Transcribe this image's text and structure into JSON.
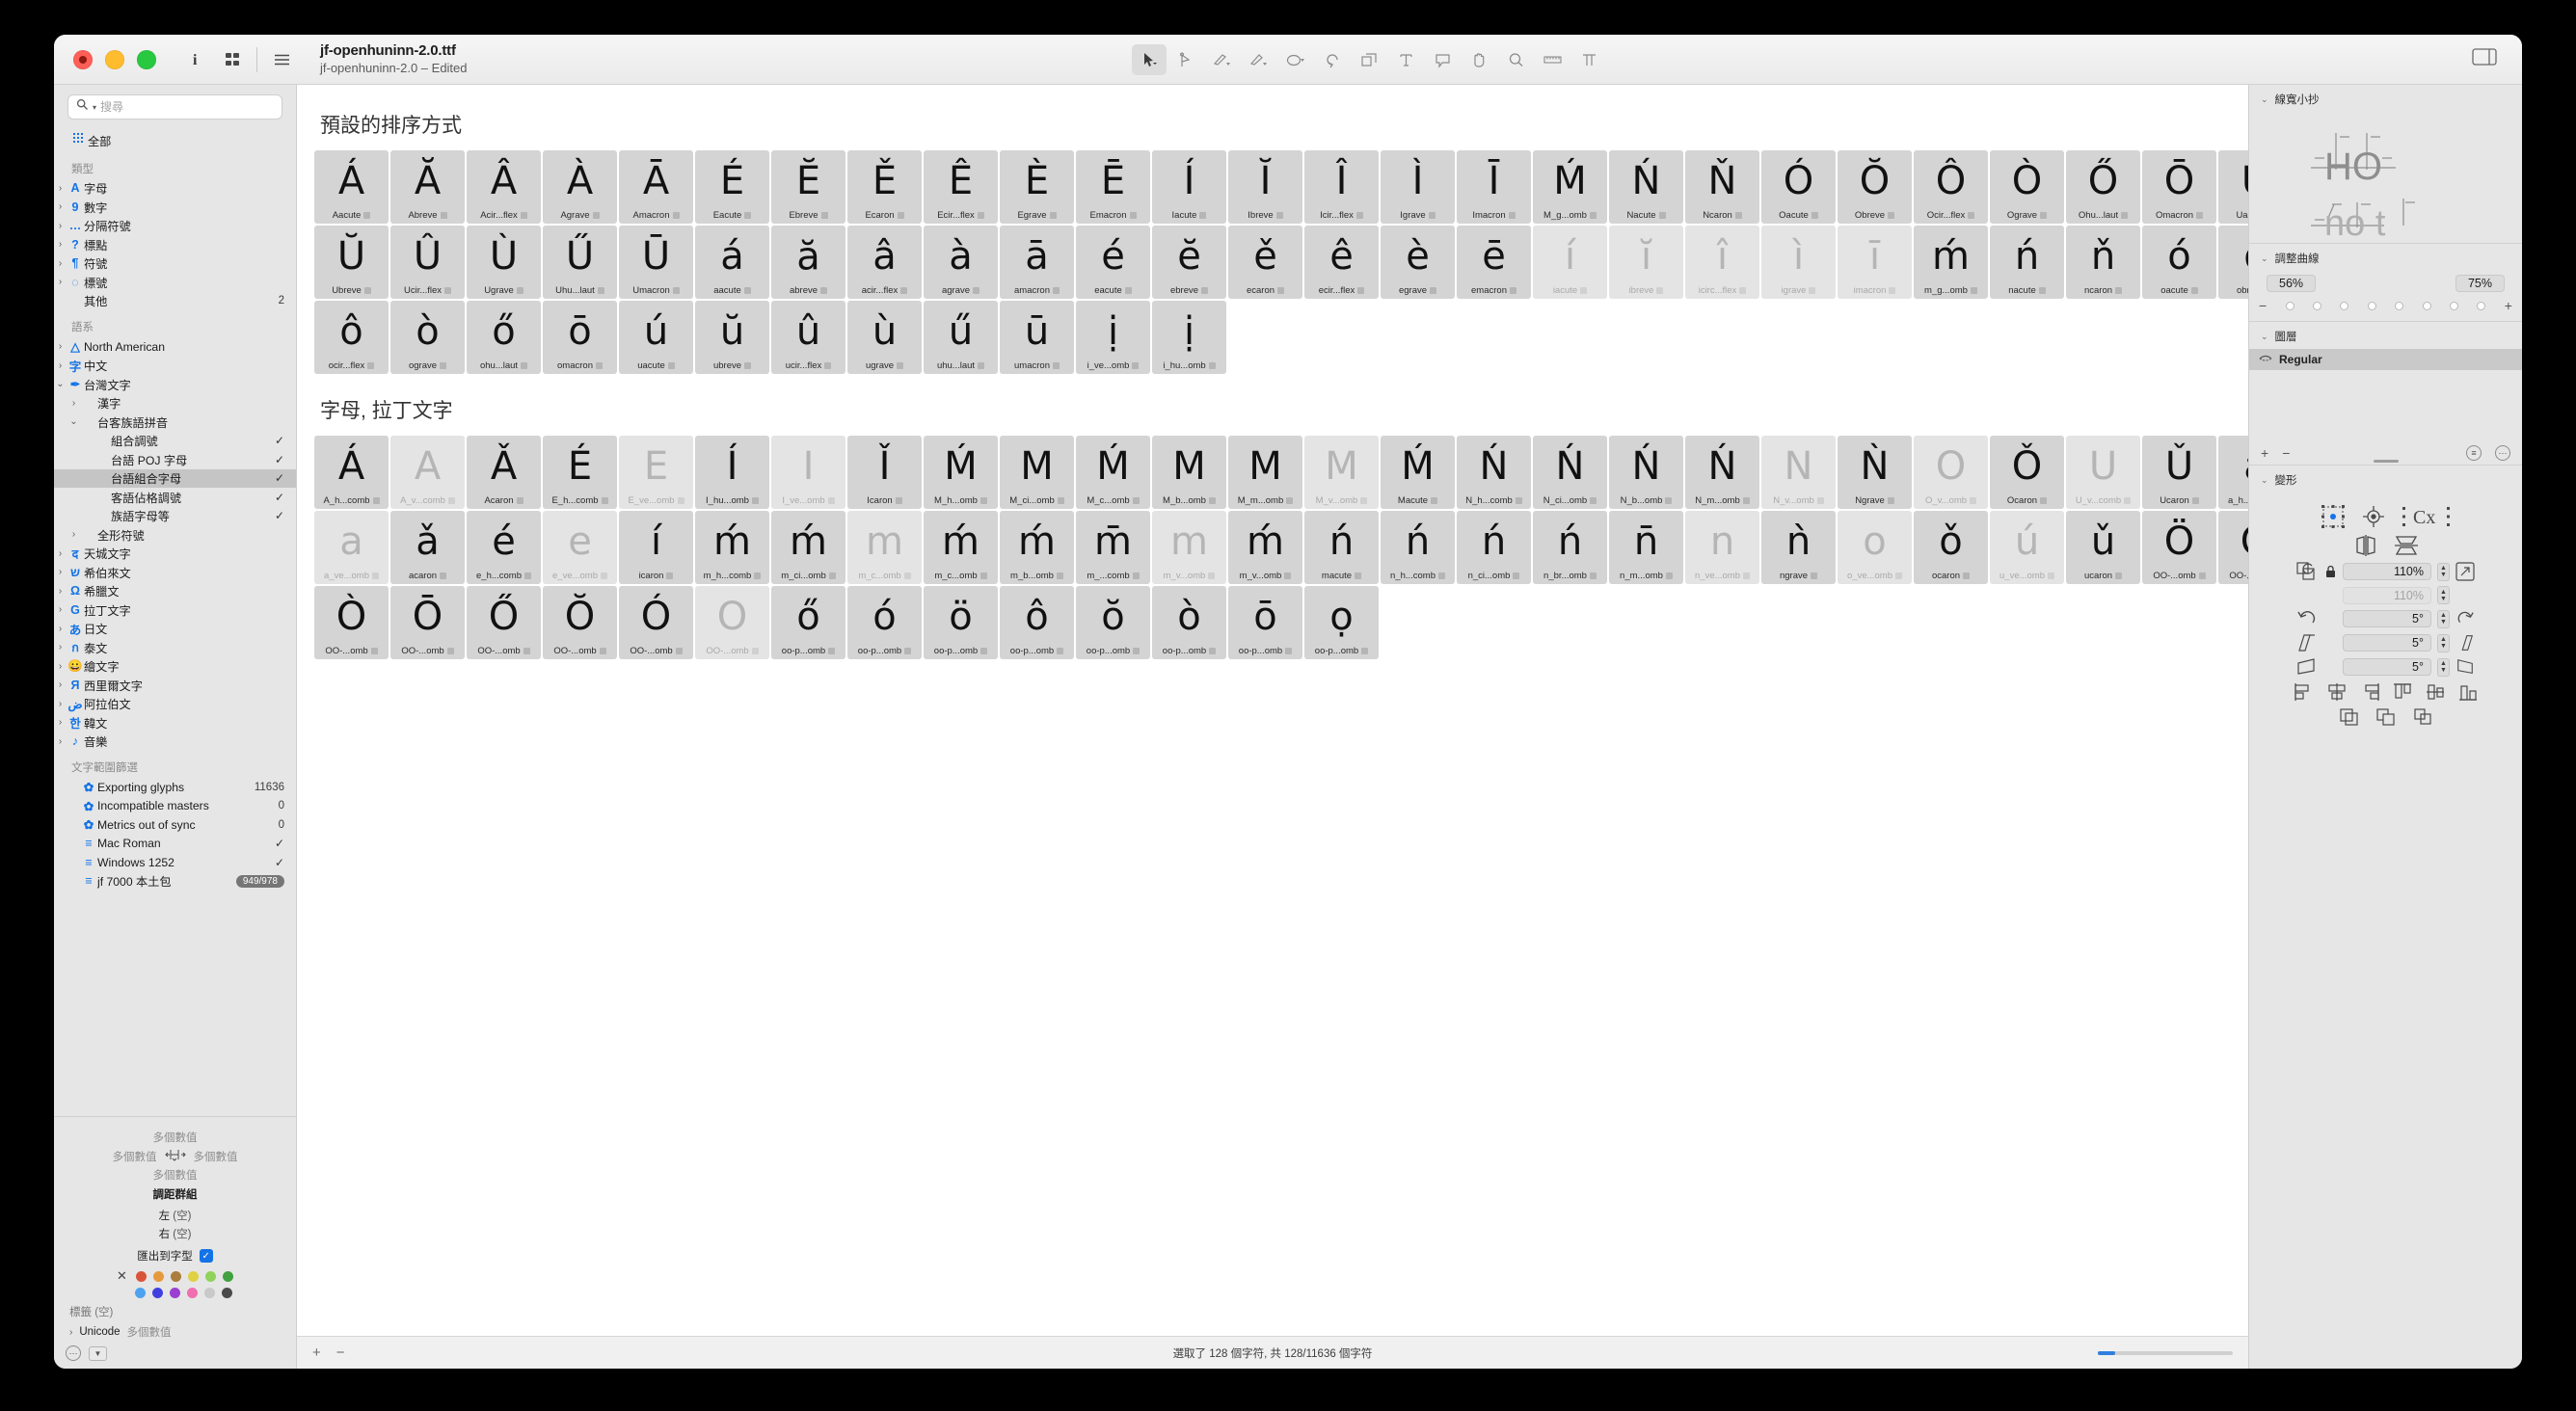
{
  "window": {
    "title": "jf-openhuninn-2.0.ttf",
    "subtitle": "jf-openhuninn-2.0 – Edited"
  },
  "titlebar": {
    "info_icon": "info-icon",
    "grid_icon": "grid-view-icon",
    "list_icon": "list-view-icon",
    "panel_toggle_icon": "right-panel-toggle-icon",
    "tools": [
      {
        "name": "select-tool",
        "glyph": "arrow",
        "active": true
      },
      {
        "name": "draw-tool",
        "glyph": "pen",
        "active": false
      },
      {
        "name": "pencil-tool",
        "glyph": "pencil",
        "active": false
      },
      {
        "name": "primitives-tool",
        "glyph": "knife",
        "active": false
      },
      {
        "name": "shape-tool",
        "glyph": "circle",
        "active": false
      },
      {
        "name": "rotate-tool",
        "glyph": "rotate",
        "active": false
      },
      {
        "name": "scale-tool",
        "glyph": "scale",
        "active": false
      },
      {
        "name": "text-tool",
        "glyph": "T",
        "active": false
      },
      {
        "name": "annotation-tool",
        "glyph": "speech",
        "active": false
      },
      {
        "name": "hand-tool",
        "glyph": "hand",
        "active": false
      },
      {
        "name": "zoom-tool",
        "glyph": "magnifier",
        "active": false
      },
      {
        "name": "measure-tool",
        "glyph": "ruler",
        "active": false
      },
      {
        "name": "text-preview-tool",
        "glyph": "TT",
        "active": false
      }
    ]
  },
  "sidebar": {
    "search": {
      "placeholder": "搜尋"
    },
    "all": {
      "label": "全部",
      "icon": "all-glyphs-icon"
    },
    "groups": [
      {
        "header": "類型",
        "items": [
          {
            "label": "字母",
            "icon": "A",
            "twisty": ">",
            "indent": 0
          },
          {
            "label": "數字",
            "icon": "9",
            "twisty": ">",
            "indent": 0
          },
          {
            "label": "分隔符號",
            "icon": "…",
            "twisty": ">",
            "indent": 0
          },
          {
            "label": "標點",
            "icon": "?",
            "twisty": ">",
            "indent": 0
          },
          {
            "label": "符號",
            "icon": "¶",
            "twisty": ">",
            "indent": 0
          },
          {
            "label": "標號",
            "icon": "◌",
            "twisty": ">",
            "indent": 0
          },
          {
            "label": "其他",
            "icon": "",
            "twisty": "",
            "indent": 0,
            "value": "2"
          }
        ]
      },
      {
        "header": "語系",
        "items": [
          {
            "label": "North American",
            "icon": "△",
            "twisty": ">",
            "indent": 0
          },
          {
            "label": "中文",
            "icon": "字",
            "twisty": ">",
            "indent": 0
          },
          {
            "label": "台灣文字",
            "icon": "✒",
            "twisty": "v",
            "indent": 0
          },
          {
            "label": "漢字",
            "icon": "",
            "twisty": ">",
            "indent": 1
          },
          {
            "label": "台客族語拼音",
            "icon": "",
            "twisty": "v",
            "indent": 1
          },
          {
            "label": "組合調號",
            "icon": "",
            "twisty": "",
            "indent": 2,
            "check": true
          },
          {
            "label": "台語 POJ 字母",
            "icon": "",
            "twisty": "",
            "indent": 2,
            "check": true
          },
          {
            "label": "台語組合字母",
            "icon": "",
            "twisty": "",
            "indent": 2,
            "check": true,
            "selected": true
          },
          {
            "label": "客語佔格調號",
            "icon": "",
            "twisty": "",
            "indent": 2,
            "check": true
          },
          {
            "label": "族語字母等",
            "icon": "",
            "twisty": "",
            "indent": 2,
            "check": true
          },
          {
            "label": "全形符號",
            "icon": "",
            "twisty": ">",
            "indent": 1
          },
          {
            "label": "天城文字",
            "icon": "द",
            "twisty": ">",
            "indent": 0
          },
          {
            "label": "希伯來文",
            "icon": "ש",
            "twisty": ">",
            "indent": 0
          },
          {
            "label": "希臘文",
            "icon": "Ω",
            "twisty": ">",
            "indent": 0
          },
          {
            "label": "拉丁文字",
            "icon": "G",
            "twisty": ">",
            "indent": 0
          },
          {
            "label": "日文",
            "icon": "あ",
            "twisty": ">",
            "indent": 0
          },
          {
            "label": "泰文",
            "icon": "ก",
            "twisty": ">",
            "indent": 0
          },
          {
            "label": "繪文字",
            "icon": "😀",
            "twisty": ">",
            "indent": 0
          },
          {
            "label": "西里爾文字",
            "icon": "Я",
            "twisty": ">",
            "indent": 0
          },
          {
            "label": "阿拉伯文",
            "icon": "ض",
            "twisty": ">",
            "indent": 0
          },
          {
            "label": "韓文",
            "icon": "한",
            "twisty": ">",
            "indent": 0
          },
          {
            "label": "音樂",
            "icon": "♪",
            "twisty": ">",
            "indent": 0
          }
        ]
      },
      {
        "header": "文字範圍篩選",
        "items": [
          {
            "label": "Exporting glyphs",
            "icon": "✿",
            "twisty": "",
            "indent": 1,
            "value": "11636"
          },
          {
            "label": "Incompatible masters",
            "icon": "✿",
            "twisty": "",
            "indent": 1,
            "value": "0"
          },
          {
            "label": "Metrics out of sync",
            "icon": "✿",
            "twisty": "",
            "indent": 1,
            "value": "0"
          },
          {
            "label": "Mac Roman",
            "icon": "≡",
            "twisty": "",
            "indent": 1,
            "check": true
          },
          {
            "label": "Windows 1252",
            "icon": "≡",
            "twisty": "",
            "indent": 1,
            "check": true
          },
          {
            "label": "jf 7000 本土包",
            "icon": "≡",
            "twisty": "",
            "indent": 1,
            "badge": "949/978"
          }
        ]
      }
    ]
  },
  "left_inspector": {
    "multi_top": "多個數值",
    "multi_left": "多個數值",
    "multi_right": "多個數值",
    "multi_bottom": "多個數值",
    "kerning_group_title": "調距群組",
    "left_label": "左",
    "left_value": "(空)",
    "right_label": "右",
    "right_value": "(空)",
    "export_label": "匯出到字型",
    "export_checked": true,
    "colors_row1": [
      "#d9533b",
      "#e79a3b",
      "#ab7c3b",
      "#e0d142",
      "#8fd35a",
      "#3fa13f"
    ],
    "colors_row2": [
      "#4ea3f0",
      "#4040e0",
      "#9a3fd0",
      "#ef6fb0",
      "#c9c9c9",
      "#4a4a4a"
    ],
    "tag_label": "標籤",
    "tag_value": "(空)",
    "unicode_label": "Unicode",
    "unicode_value": "多個數值"
  },
  "main": {
    "sections": [
      {
        "title": "預設的排序方式",
        "glyphs": [
          {
            "g": "Á",
            "n": "Aacute"
          },
          {
            "g": "Ă",
            "n": "Abreve"
          },
          {
            "g": "Â",
            "n": "Acir...flex"
          },
          {
            "g": "À",
            "n": "Agrave"
          },
          {
            "g": "Ā",
            "n": "Amacron"
          },
          {
            "g": "É",
            "n": "Eacute"
          },
          {
            "g": "Ĕ",
            "n": "Ebreve"
          },
          {
            "g": "Ě",
            "n": "Ecaron"
          },
          {
            "g": "Ê",
            "n": "Ecir...flex"
          },
          {
            "g": "È",
            "n": "Egrave"
          },
          {
            "g": "Ē",
            "n": "Emacron"
          },
          {
            "g": "Í",
            "n": "Iacute"
          },
          {
            "g": "Ĭ",
            "n": "Ibreve"
          },
          {
            "g": "Î",
            "n": "Icir...flex"
          },
          {
            "g": "Ì",
            "n": "Igrave"
          },
          {
            "g": "Ī",
            "n": "Imacron"
          },
          {
            "g": "Ḿ",
            "n": "M_g...omb"
          },
          {
            "g": "Ń",
            "n": "Nacute"
          },
          {
            "g": "Ň",
            "n": "Ncaron"
          },
          {
            "g": "Ó",
            "n": "Oacute"
          },
          {
            "g": "Ŏ",
            "n": "Obreve"
          },
          {
            "g": "Ô",
            "n": "Ocir...flex"
          },
          {
            "g": "Ò",
            "n": "Ograve"
          },
          {
            "g": "Ő",
            "n": "Ohu...laut"
          },
          {
            "g": "Ō",
            "n": "Omacron"
          },
          {
            "g": "Ú",
            "n": "Uacute"
          },
          {
            "g": "Ŭ",
            "n": "Ubreve"
          },
          {
            "g": "Û",
            "n": "Ucir...flex"
          },
          {
            "g": "Ù",
            "n": "Ugrave"
          },
          {
            "g": "Ű",
            "n": "Uhu...laut"
          },
          {
            "g": "Ū",
            "n": "Umacron"
          },
          {
            "g": "á",
            "n": "aacute"
          },
          {
            "g": "ă",
            "n": "abreve"
          },
          {
            "g": "â",
            "n": "acir...flex"
          },
          {
            "g": "à",
            "n": "agrave"
          },
          {
            "g": "ā",
            "n": "amacron"
          },
          {
            "g": "é",
            "n": "eacute"
          },
          {
            "g": "ĕ",
            "n": "ebreve"
          },
          {
            "g": "ě",
            "n": "ecaron"
          },
          {
            "g": "ê",
            "n": "ecir...flex"
          },
          {
            "g": "è",
            "n": "egrave"
          },
          {
            "g": "ē",
            "n": "emacron"
          },
          {
            "g": "í",
            "n": "iacute",
            "dim": true
          },
          {
            "g": "ĭ",
            "n": "ibreve",
            "dim": true
          },
          {
            "g": "î",
            "n": "icirc...flex",
            "dim": true
          },
          {
            "g": "ì",
            "n": "igrave",
            "dim": true
          },
          {
            "g": "ī",
            "n": "imacron",
            "dim": true
          },
          {
            "g": "ḿ",
            "n": "m_g...omb"
          },
          {
            "g": "ń",
            "n": "nacute"
          },
          {
            "g": "ň",
            "n": "ncaron"
          },
          {
            "g": "ó",
            "n": "oacute"
          },
          {
            "g": "ŏ",
            "n": "obreve"
          },
          {
            "g": "ô",
            "n": "ocir...flex"
          },
          {
            "g": "ò",
            "n": "ograve"
          },
          {
            "g": "ő",
            "n": "ohu...laut"
          },
          {
            "g": "ō",
            "n": "omacron"
          },
          {
            "g": "ú",
            "n": "uacute"
          },
          {
            "g": "ŭ",
            "n": "ubreve"
          },
          {
            "g": "û",
            "n": "ucir...flex"
          },
          {
            "g": "ù",
            "n": "ugrave"
          },
          {
            "g": "ű",
            "n": "uhu...laut"
          },
          {
            "g": "ū",
            "n": "umacron"
          },
          {
            "g": "ị",
            "n": "i_ve...omb"
          },
          {
            "g": "ị",
            "n": "i_hu...omb"
          }
        ]
      },
      {
        "title": "字母, 拉丁文字",
        "glyphs": [
          {
            "g": "Á",
            "n": "A_h...comb"
          },
          {
            "g": "A",
            "n": "A_v...comb",
            "dim": true
          },
          {
            "g": "Ǎ",
            "n": "Acaron"
          },
          {
            "g": "É",
            "n": "E_h...comb"
          },
          {
            "g": "E",
            "n": "E_ve...omb",
            "dim": true
          },
          {
            "g": "Í",
            "n": "I_hu...omb"
          },
          {
            "g": "I",
            "n": "I_ve...omb",
            "dim": true
          },
          {
            "g": "Ǐ",
            "n": "Icaron"
          },
          {
            "g": "Ḿ",
            "n": "M_h...omb"
          },
          {
            "g": "M",
            "n": "M_ci...omb"
          },
          {
            "g": "Ḿ",
            "n": "M_c...omb"
          },
          {
            "g": "M",
            "n": "M_b...omb"
          },
          {
            "g": "M",
            "n": "M_m...omb"
          },
          {
            "g": "M",
            "n": "M_v...omb",
            "dim": true
          },
          {
            "g": "Ḿ",
            "n": "Macute"
          },
          {
            "g": "Ń",
            "n": "N_h...comb"
          },
          {
            "g": "Ń",
            "n": "N_ci...omb"
          },
          {
            "g": "Ń",
            "n": "N_b...omb"
          },
          {
            "g": "Ń",
            "n": "N_m...omb"
          },
          {
            "g": "N",
            "n": "N_v...omb",
            "dim": true
          },
          {
            "g": "Ǹ",
            "n": "Ngrave"
          },
          {
            "g": "O",
            "n": "O_v...omb",
            "dim": true
          },
          {
            "g": "Ǒ",
            "n": "Ocaron"
          },
          {
            "g": "U",
            "n": "U_v...comb",
            "dim": true
          },
          {
            "g": "Ǔ",
            "n": "Ucaron"
          },
          {
            "g": "á",
            "n": "a_h...comb"
          },
          {
            "g": "a",
            "n": "a_ve...omb",
            "dim": true
          },
          {
            "g": "ǎ",
            "n": "acaron"
          },
          {
            "g": "é",
            "n": "e_h...comb"
          },
          {
            "g": "e",
            "n": "e_ve...omb",
            "dim": true
          },
          {
            "g": "í",
            "n": "icaron"
          },
          {
            "g": "ḿ",
            "n": "m_h...comb"
          },
          {
            "g": "ḿ",
            "n": "m_ci...omb"
          },
          {
            "g": "m",
            "n": "m_c...omb",
            "dim": true
          },
          {
            "g": "ḿ",
            "n": "m_c...omb"
          },
          {
            "g": "ḿ",
            "n": "m_b...omb"
          },
          {
            "g": "m̄",
            "n": "m_...comb"
          },
          {
            "g": "m",
            "n": "m_v...omb",
            "dim": true
          },
          {
            "g": "ḿ",
            "n": "m_v...omb"
          },
          {
            "g": "ń",
            "n": "macute"
          },
          {
            "g": "ń",
            "n": "n_h...comb"
          },
          {
            "g": "ń",
            "n": "n_ci...omb"
          },
          {
            "g": "ń",
            "n": "n_br...omb"
          },
          {
            "g": "n̄",
            "n": "n_m...omb"
          },
          {
            "g": "n",
            "n": "n_ve...omb",
            "dim": true
          },
          {
            "g": "ǹ",
            "n": "ngrave"
          },
          {
            "g": "o",
            "n": "o_ve...omb",
            "dim": true
          },
          {
            "g": "ǒ",
            "n": "ocaron"
          },
          {
            "g": "ú",
            "n": "u_ve...omb",
            "dim": true
          },
          {
            "g": "ǔ",
            "n": "ucaron"
          },
          {
            "g": "Ö",
            "n": "OO-...omb"
          },
          {
            "g": "Ô",
            "n": "OO-...omb"
          },
          {
            "g": "Ò",
            "n": "OO-...omb"
          },
          {
            "g": "Ō",
            "n": "OO-...omb"
          },
          {
            "g": "Ő",
            "n": "OO-...omb"
          },
          {
            "g": "Ŏ",
            "n": "OO-...omb"
          },
          {
            "g": "Ó",
            "n": "OO-...omb"
          },
          {
            "g": "O",
            "n": "OO-...omb",
            "dim": true
          },
          {
            "g": "ő",
            "n": "oo-p...omb"
          },
          {
            "g": "ó",
            "n": "oo-p...omb"
          },
          {
            "g": "ö",
            "n": "oo-p...omb"
          },
          {
            "g": "ô",
            "n": "oo-p...omb"
          },
          {
            "g": "ŏ",
            "n": "oo-p...omb"
          },
          {
            "g": "ò",
            "n": "oo-p...omb"
          },
          {
            "g": "ō",
            "n": "oo-p...omb"
          },
          {
            "g": "ọ",
            "n": "oo-p...omb"
          }
        ]
      }
    ]
  },
  "statusbar": {
    "plus": "+",
    "minus": "−",
    "status": "選取了 128 個字符, 共 128/11636 個字符"
  },
  "right_panel": {
    "width_cheatsheet": {
      "title": "線寬小抄",
      "row1": "HO",
      "row2": "no t"
    },
    "adjust_curve": {
      "title": "調整曲線",
      "left_pct": "56%",
      "right_pct": "75%",
      "minus": "−",
      "plus": "+",
      "dots": 8
    },
    "layers": {
      "title": "圖層",
      "items": [
        {
          "label": "Regular",
          "selected": true
        }
      ]
    },
    "transform": {
      "title": "變形",
      "scale_value": "110%",
      "scale_value_2": "110%",
      "rotate_value": "5°",
      "slant_value": "5°",
      "skew_value": "5°",
      "icons": [
        "transform-origin-icon",
        "align-center-icon",
        "Cx-icon",
        "flip-horizontal-icon",
        "flip-vertical-icon",
        "scale-down-icon",
        "lock-icon",
        "scale-up-icon",
        "rotate-ccw-icon",
        "rotate-cw-icon",
        "slant-left-icon",
        "slant-right-icon",
        "skew-left-icon",
        "skew-right-icon",
        "align-left-icon",
        "align-hcenter-icon",
        "align-right-icon",
        "align-top-icon",
        "align-vcenter-icon",
        "align-bottom-icon",
        "union-icon",
        "subtract-icon",
        "intersect-icon"
      ]
    }
  }
}
